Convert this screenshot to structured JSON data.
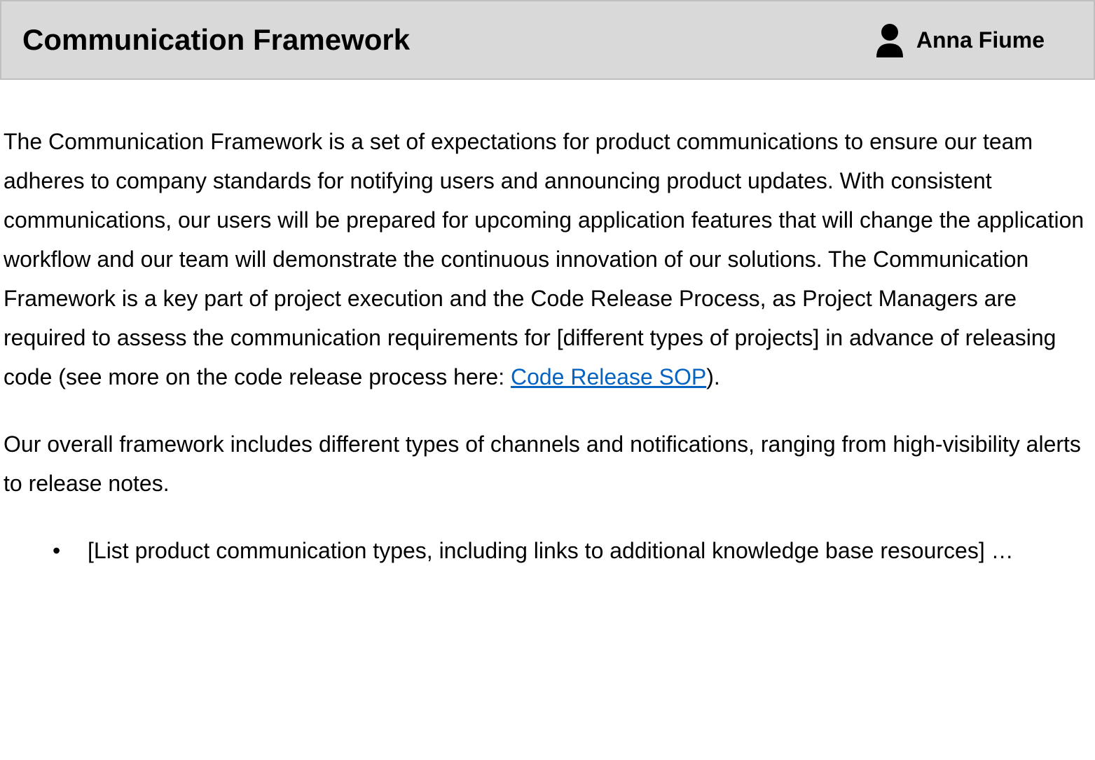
{
  "header": {
    "title": "Communication Framework",
    "user_name": "Anna Fiume"
  },
  "content": {
    "paragraph1_part1": "The Communication Framework is a set of expectations for product communications to ensure our team adheres to company standards for notifying users and announcing product updates. With consistent communications, our users will be prepared for upcoming application features that will change the application workflow and our team will demonstrate the continuous innovation of our solutions. The Communication Framework is a key part of project execution and the Code Release Process, as Project Managers are required to assess the communication requirements for [different types of projects] in advance of releasing code (see more on the code release process here: ",
    "paragraph1_link": "Code Release SOP",
    "paragraph1_part2": ").",
    "paragraph2": "Our overall framework includes different types of channels and notifications, ranging from high-visibility alerts to release notes.",
    "bullet1": "[List product communication types, including links to additional knowledge base resources] …"
  }
}
